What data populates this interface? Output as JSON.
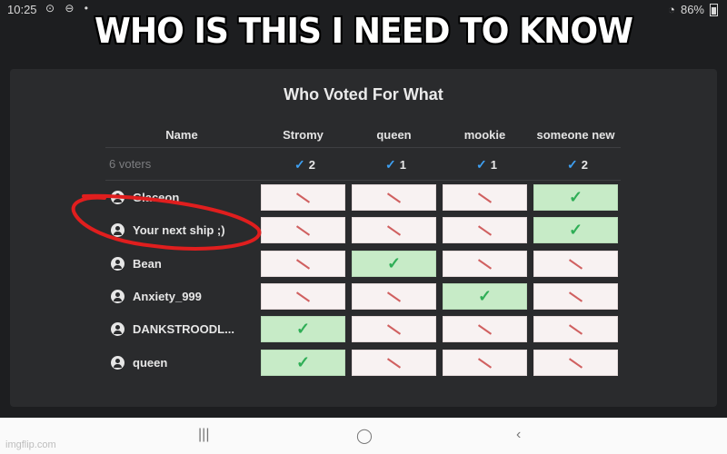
{
  "status": {
    "time": "10:25",
    "battery": "86%"
  },
  "caption": "WHO IS THIS I NEED TO KNOW",
  "poll": {
    "title": "Who Voted For What",
    "name_header": "Name",
    "voters": "6 voters",
    "options": [
      {
        "label": "Stromy",
        "count": "2"
      },
      {
        "label": "queen",
        "count": "1"
      },
      {
        "label": "mookie",
        "count": "1"
      },
      {
        "label": "someone new",
        "count": "2"
      }
    ],
    "rows": [
      {
        "name": "Glaceon",
        "votes": [
          false,
          false,
          false,
          true
        ]
      },
      {
        "name": "Your next ship ;)",
        "votes": [
          false,
          false,
          false,
          true
        ]
      },
      {
        "name": "Bean",
        "votes": [
          false,
          true,
          false,
          false
        ]
      },
      {
        "name": "Anxiety_999",
        "votes": [
          false,
          false,
          true,
          false
        ]
      },
      {
        "name": "DANKSTROODL...",
        "votes": [
          true,
          false,
          false,
          false
        ]
      },
      {
        "name": "queen",
        "votes": [
          true,
          false,
          false,
          false
        ]
      }
    ]
  },
  "watermark": "imgflip.com",
  "colors": {
    "accent_check": "#3ea0f2",
    "vote_yes": "#c7ebc7",
    "vote_no": "#f8f2f2",
    "circle": "#e01e1e"
  }
}
